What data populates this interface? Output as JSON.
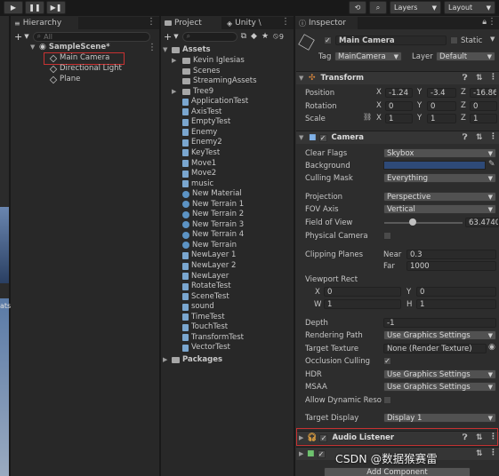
{
  "toolbar": {
    "history_icon": "history-icon",
    "search_icon": "search-icon",
    "layers_label": "Layers",
    "layout_label": "Layout"
  },
  "hierarchy": {
    "tab_label": "Hierarchy",
    "add_label": "+",
    "search_placeholder": "All",
    "scene_name": "SampleScene*",
    "items": [
      "Main Camera",
      "Directional Light",
      "Plane"
    ]
  },
  "project": {
    "tab_label": "Project",
    "second_tab_label": "Unity \\",
    "add_label": "+",
    "badge": "9",
    "root_label": "Assets",
    "items": [
      "Kevin Iglesias",
      "Scenes",
      "StreamingAssets",
      "Tree9",
      "ApplicationTest",
      "AxisTest",
      "EmptyTest",
      "Enemy",
      "Enemy2",
      "KeyTest",
      "Move1",
      "Move2",
      "music",
      "New Material",
      "New Terrain 1",
      "New Terrain 2",
      "New Terrain 3",
      "New Terrain 4",
      "New Terrain",
      "NewLayer 1",
      "NewLayer 2",
      "NewLayer",
      "RotateTest",
      "SceneTest",
      "sound",
      "TimeTest",
      "TouchTest",
      "TransformTest",
      "VectorTest"
    ],
    "packages_label": "Packages"
  },
  "left_strip": {
    "label": "ats"
  },
  "inspector": {
    "tab_label": "Inspector",
    "object_name": "Main Camera",
    "static_label": "Static",
    "tag_label": "Tag",
    "tag_value": "MainCamera",
    "layer_label": "Layer",
    "layer_value": "Default",
    "transform": {
      "title": "Transform",
      "position_label": "Position",
      "rotation_label": "Rotation",
      "scale_label": "Scale",
      "position": {
        "x": "-1.24",
        "y": "-3.4",
        "z": "-16.86"
      },
      "rotation": {
        "x": "0",
        "y": "0",
        "z": "0"
      },
      "scale": {
        "x": "1",
        "y": "1",
        "z": "1"
      }
    },
    "camera": {
      "title": "Camera",
      "clear_flags_label": "Clear Flags",
      "clear_flags_value": "Skybox",
      "background_label": "Background",
      "background_color": "#2e4a78",
      "culling_mask_label": "Culling Mask",
      "culling_mask_value": "Everything",
      "projection_label": "Projection",
      "projection_value": "Perspective",
      "fov_axis_label": "FOV Axis",
      "fov_axis_value": "Vertical",
      "field_of_view_label": "Field of View",
      "field_of_view_value": "63.4740",
      "physical_camera_label": "Physical Camera",
      "clipping_planes_label": "Clipping Planes",
      "near_label": "Near",
      "near_value": "0.3",
      "far_label": "Far",
      "far_value": "1000",
      "viewport_rect_label": "Viewport Rect",
      "vp_x_label": "X",
      "vp_x": "0",
      "vp_y_label": "Y",
      "vp_y": "0",
      "vp_w_label": "W",
      "vp_w": "1",
      "vp_h_label": "H",
      "vp_h": "1",
      "depth_label": "Depth",
      "depth_value": "-1",
      "rendering_path_label": "Rendering Path",
      "rendering_path_value": "Use Graphics Settings",
      "target_texture_label": "Target Texture",
      "target_texture_value": "None (Render Texture)",
      "occlusion_culling_label": "Occlusion Culling",
      "hdr_label": "HDR",
      "hdr_value": "Use Graphics Settings",
      "msaa_label": "MSAA",
      "msaa_value": "Use Graphics Settings",
      "allow_dynamic_label": "Allow Dynamic Reso",
      "target_display_label": "Target Display",
      "target_display_value": "Display 1"
    },
    "audio_listener": {
      "title": "Audio Listener"
    },
    "add_component_label": "Add Component"
  },
  "watermark": "CSDN @数据猴赛雷",
  "colors": {
    "selection_outline": "#c83232",
    "panel_bg": "#282828"
  }
}
